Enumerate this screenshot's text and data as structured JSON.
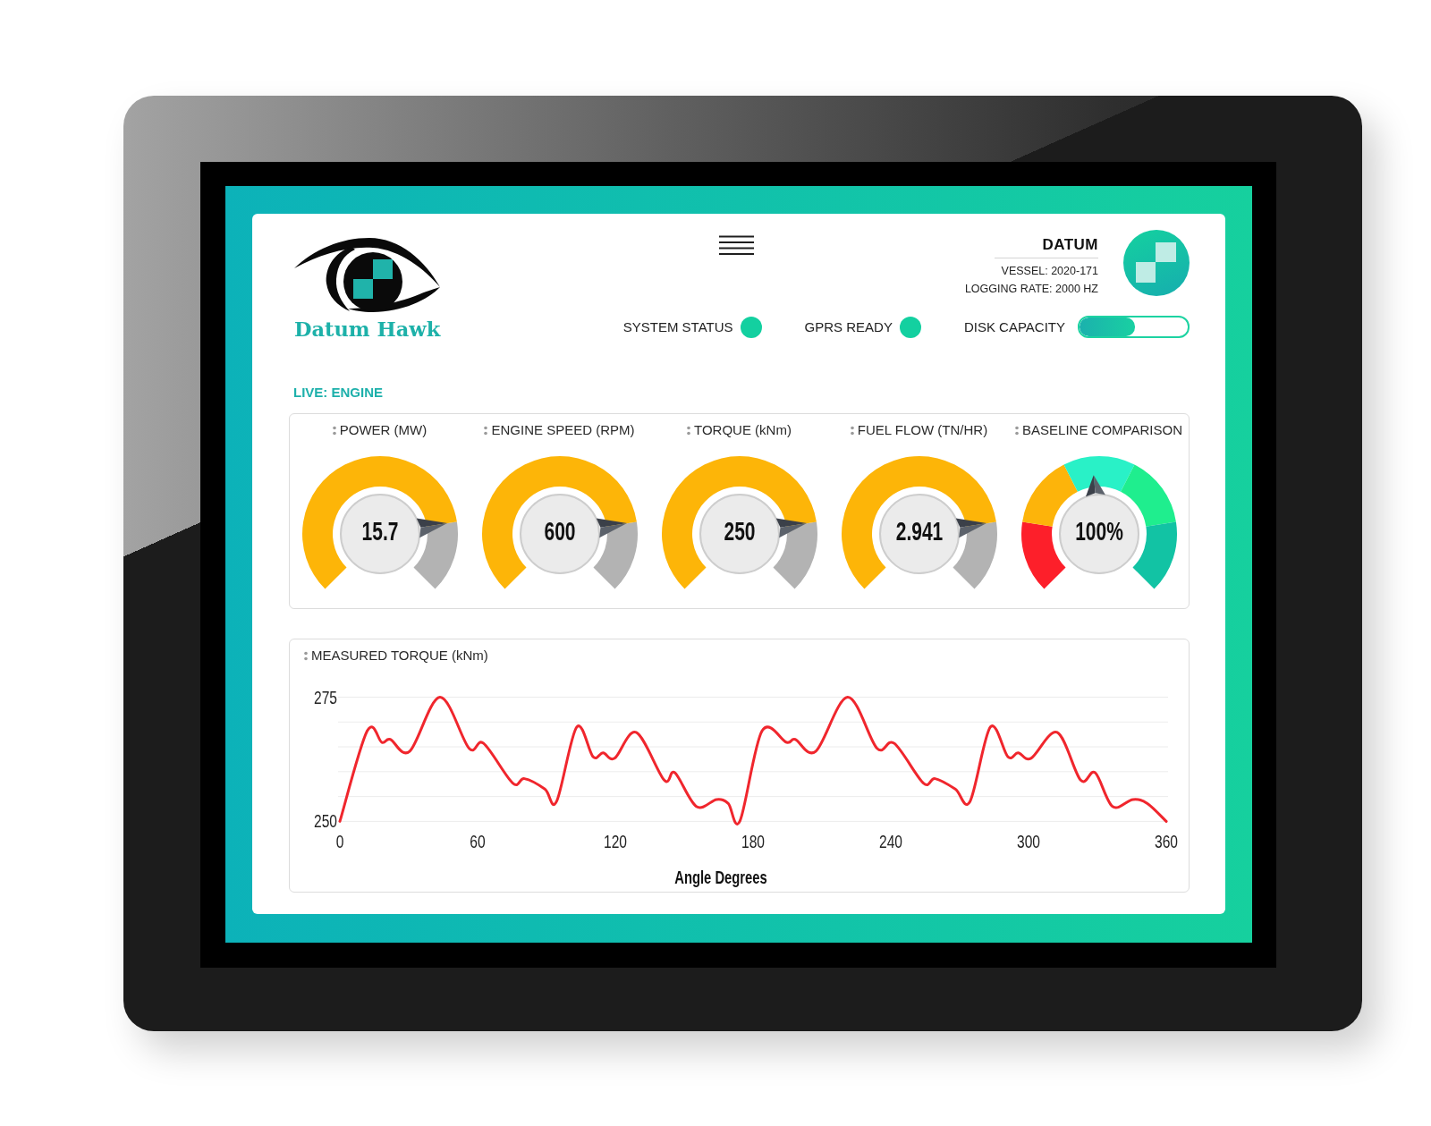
{
  "brand": {
    "name": "Datum Hawk"
  },
  "header": {
    "title": "DATUM",
    "details": [
      "VESSEL: 2020-171",
      "LOGGING RATE: 2000 HZ"
    ]
  },
  "indicators": [
    {
      "label": "SYSTEM STATUS",
      "on": true
    },
    {
      "label": "GPRS READY",
      "on": true
    }
  ],
  "disk_capacity": {
    "label": "DISK CAPACITY",
    "level": 0.51
  },
  "section": {
    "title": "LIVE: ENGINE"
  },
  "gauges": [
    {
      "kind": "single",
      "label": "POWER (MW)",
      "value": "15.7",
      "level": 0.8
    },
    {
      "kind": "single",
      "label": "ENGINE SPEED (RPM)",
      "value": "600",
      "level": 0.8
    },
    {
      "kind": "single",
      "label": "TORQUE (kNm)",
      "value": "250",
      "level": 0.8
    },
    {
      "kind": "single",
      "label": "FUEL FLOW (TN/HR)",
      "value": "2.941",
      "level": 0.8
    },
    {
      "kind": "segmented",
      "label": "BASELINE COMPARISON",
      "value": "100%",
      "level": 0.48
    }
  ],
  "measured_torque": {
    "chart_data": {
      "type": "line",
      "title": "MEASURED TORQUE (kNm)",
      "xlabel": "Angle Degrees",
      "x": [
        0,
        11.9,
        18.3,
        22,
        30.4,
        43.6,
        56.3,
        62.6,
        75.3,
        80.4,
        89.3,
        94.4,
        103.2,
        110.3,
        114.7,
        119.7,
        129.1,
        141.3,
        145.9,
        155.3,
        164.1,
        169.2,
        174.3,
        183.9,
        194.6,
        198.4,
        207.3,
        221.2,
        234,
        241.5,
        254.2,
        259.3,
        268.1,
        274.5,
        283.4,
        291,
        295.5,
        301.1,
        312.5,
        322.7,
        329,
        336.6,
        345.5,
        351.8,
        360
      ],
      "series": [
        {
          "color": "#f0262d",
          "values": [
            250,
            268.2,
            265.9,
            266.5,
            264.1,
            275,
            264.7,
            265.7,
            257.7,
            258.6,
            256.5,
            254,
            269,
            263,
            263.8,
            262.7,
            267.9,
            258.3,
            259.8,
            253,
            254.4,
            253.6,
            250.1,
            268.2,
            265.9,
            266.5,
            264.1,
            275,
            264.7,
            265.7,
            257.7,
            258.6,
            256.5,
            254,
            269,
            263,
            263.8,
            262.7,
            267.9,
            258.3,
            259.8,
            253,
            254.4,
            253.6,
            250
          ]
        }
      ],
      "xlim": [
        0,
        360
      ],
      "ylim": [
        250,
        275
      ],
      "xticks": [
        0,
        60,
        120,
        180,
        240,
        300,
        360
      ],
      "yticks": [
        250,
        275
      ]
    }
  }
}
